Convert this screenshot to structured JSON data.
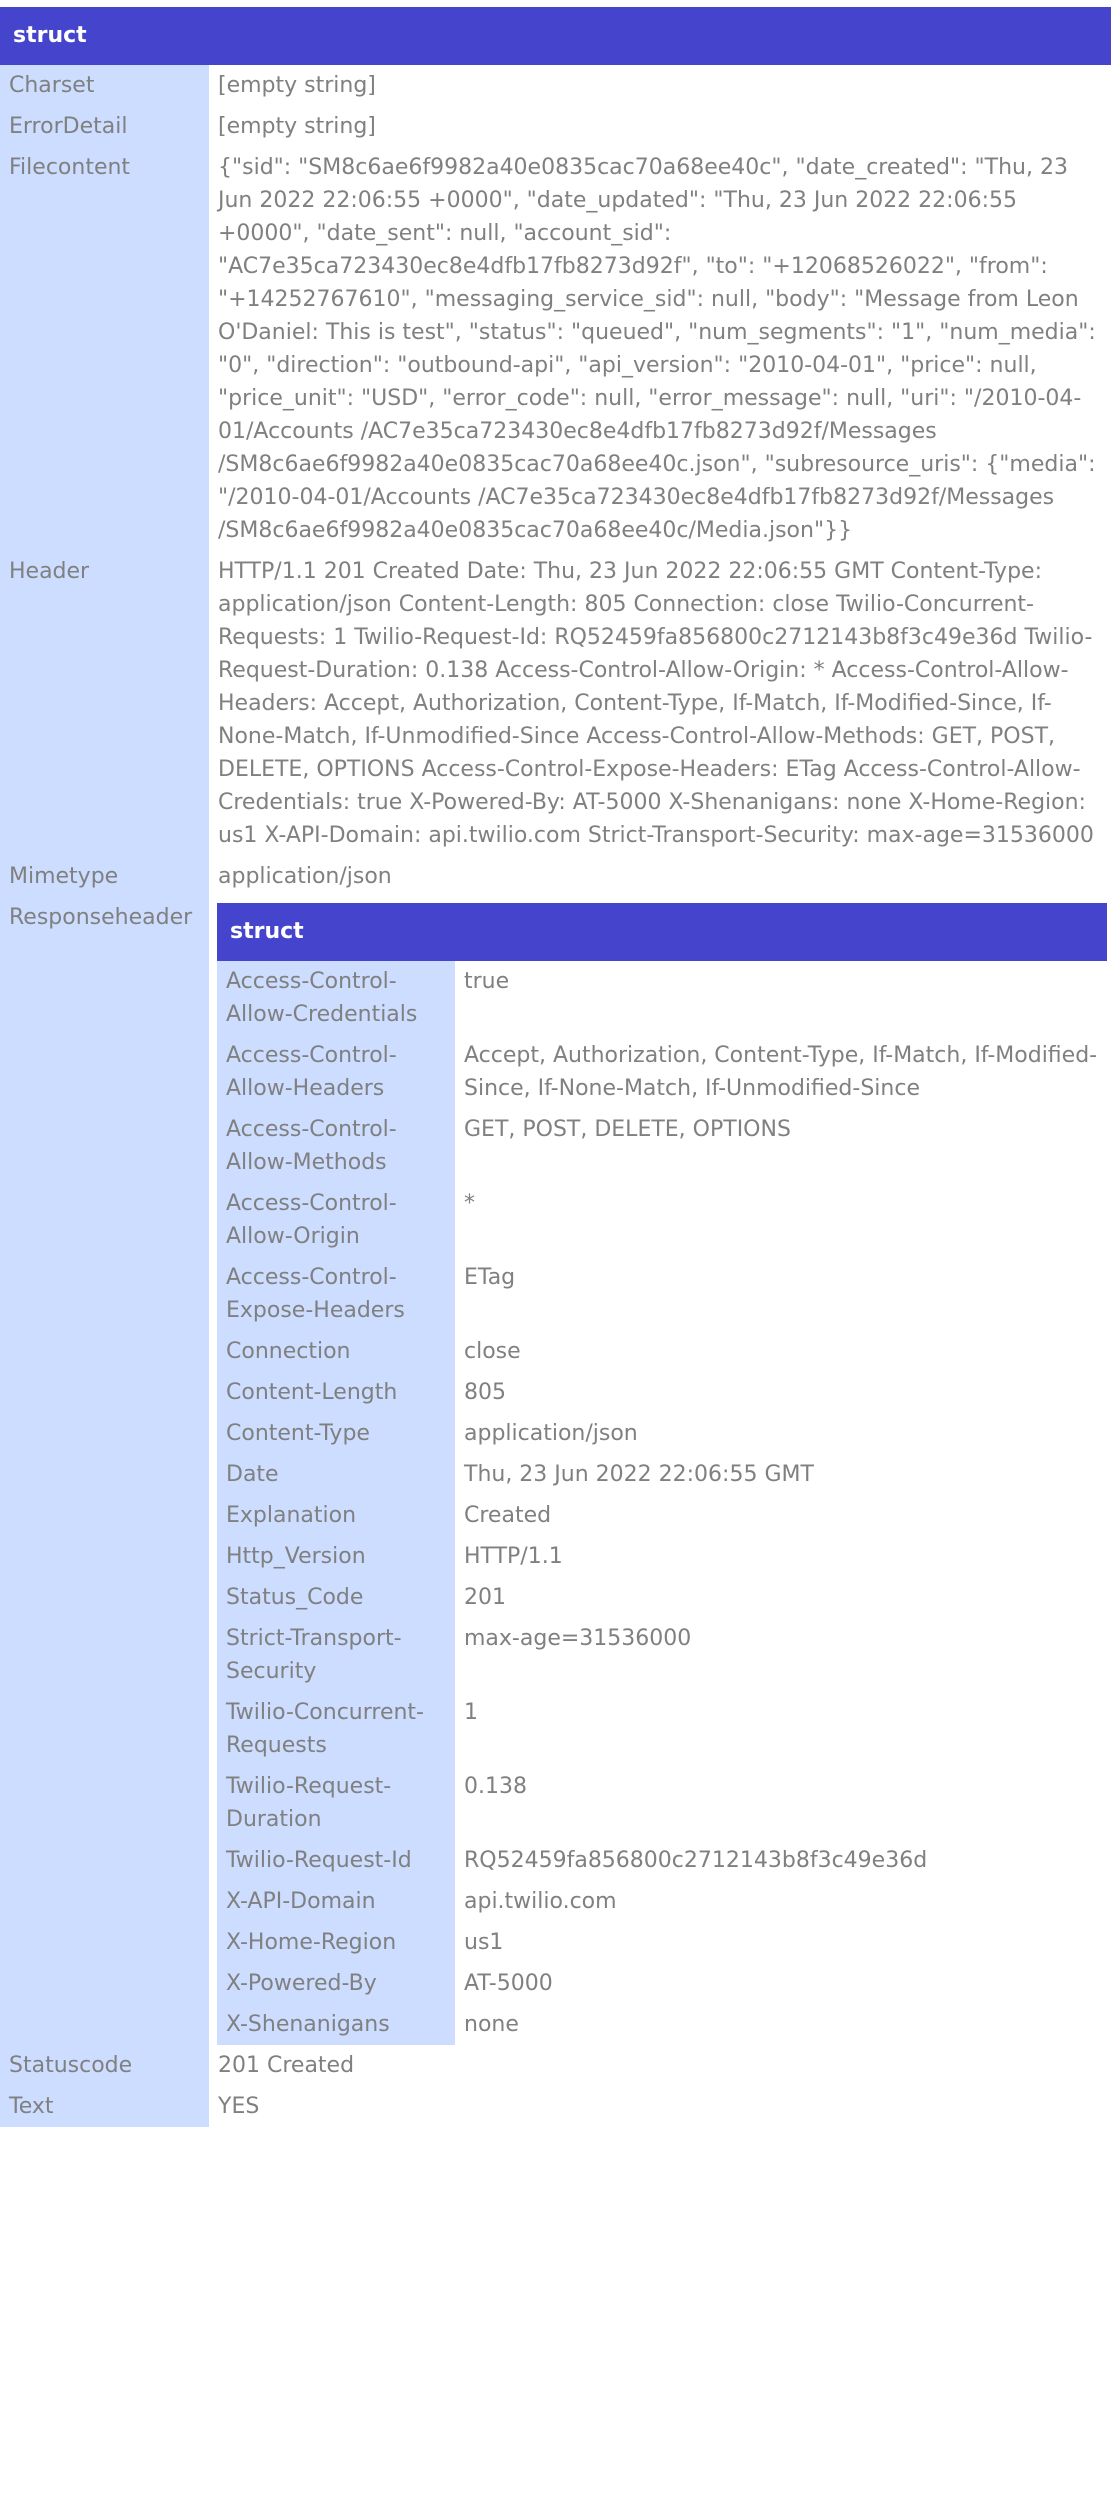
{
  "dump": {
    "title": "struct",
    "rows": [
      {
        "key": "Charset",
        "value": "[empty string]"
      },
      {
        "key": "ErrorDetail",
        "value": "[empty string]"
      },
      {
        "key": "Filecontent",
        "value": "{\"sid\": \"SM8c6ae6f9982a40e0835cac70a68ee40c\", \"date_created\": \"Thu, 23 Jun 2022 22:06:55 +0000\", \"date_updated\": \"Thu, 23 Jun 2022 22:06:55 +0000\", \"date_sent\": null, \"account_sid\": \"AC7e35ca723430ec8e4dfb17fb8273d92f\", \"to\": \"+12068526022\", \"from\": \"+14252767610\", \"messaging_service_sid\": null, \"body\": \"Message from Leon O'Daniel: This is test\", \"status\": \"queued\", \"num_segments\": \"1\", \"num_media\": \"0\", \"direction\": \"outbound-api\", \"api_version\": \"2010-04-01\", \"price\": null, \"price_unit\": \"USD\", \"error_code\": null, \"error_message\": null, \"uri\": \"/2010-04-01/Accounts /AC7e35ca723430ec8e4dfb17fb8273d92f/Messages /SM8c6ae6f9982a40e0835cac70a68ee40c.json\", \"subresource_uris\": {\"media\": \"/2010-04-01/Accounts /AC7e35ca723430ec8e4dfb17fb8273d92f/Messages /SM8c6ae6f9982a40e0835cac70a68ee40c/Media.json\"}}"
      },
      {
        "key": "Header",
        "value": "HTTP/1.1 201 Created Date: Thu, 23 Jun 2022 22:06:55 GMT Content-Type: application/json Content-Length: 805 Connection: close Twilio-Concurrent-Requests: 1 Twilio-Request-Id: RQ52459fa856800c2712143b8f3c49e36d Twilio-Request-Duration: 0.138 Access-Control-Allow-Origin: * Access-Control-Allow-Headers: Accept, Authorization, Content-Type, If-Match, If-Modified-Since, If-None-Match, If-Unmodified-Since Access-Control-Allow-Methods: GET, POST, DELETE, OPTIONS Access-Control-Expose-Headers: ETag Access-Control-Allow-Credentials: true X-Powered-By: AT-5000 X-Shenanigans: none X-Home-Region: us1 X-API-Domain: api.twilio.com Strict-Transport-Security: max-age=31536000"
      },
      {
        "key": "Mimetype",
        "value": "application/json"
      }
    ],
    "responseheader": {
      "key": "Responseheader",
      "title": "struct",
      "rows": [
        {
          "key": "Access-Control-Allow-Credentials",
          "value": "true"
        },
        {
          "key": "Access-Control-Allow-Headers",
          "value": "Accept, Authorization, Content-Type, If-Match, If-Modified-Since, If-None-Match, If-Unmodified-Since"
        },
        {
          "key": "Access-Control-Allow-Methods",
          "value": "GET, POST, DELETE, OPTIONS"
        },
        {
          "key": "Access-Control-Allow-Origin",
          "value": "*"
        },
        {
          "key": "Access-Control-Expose-Headers",
          "value": "ETag"
        },
        {
          "key": "Connection",
          "value": "close"
        },
        {
          "key": "Content-Length",
          "value": "805"
        },
        {
          "key": "Content-Type",
          "value": "application/json"
        },
        {
          "key": "Date",
          "value": "Thu, 23 Jun 2022 22:06:55 GMT"
        },
        {
          "key": "Explanation",
          "value": "Created"
        },
        {
          "key": "Http_Version",
          "value": "HTTP/1.1"
        },
        {
          "key": "Status_Code",
          "value": "201"
        },
        {
          "key": "Strict-Transport-Security",
          "value": "max-age=31536000"
        },
        {
          "key": "Twilio-Concurrent-Requests",
          "value": "1"
        },
        {
          "key": "Twilio-Request-Duration",
          "value": "0.138"
        },
        {
          "key": "Twilio-Request-Id",
          "value": "RQ52459fa856800c2712143b8f3c49e36d"
        },
        {
          "key": "X-API-Domain",
          "value": "api.twilio.com"
        },
        {
          "key": "X-Home-Region",
          "value": "us1"
        },
        {
          "key": "X-Powered-By",
          "value": "AT-5000"
        },
        {
          "key": "X-Shenanigans",
          "value": "none"
        }
      ]
    },
    "tail_rows": [
      {
        "key": "Statuscode",
        "value": "201 Created"
      },
      {
        "key": "Text",
        "value": "YES"
      }
    ]
  },
  "colors": {
    "header_bg": "#4444cc",
    "key_bg": "#ccddff",
    "text": "#808080"
  }
}
